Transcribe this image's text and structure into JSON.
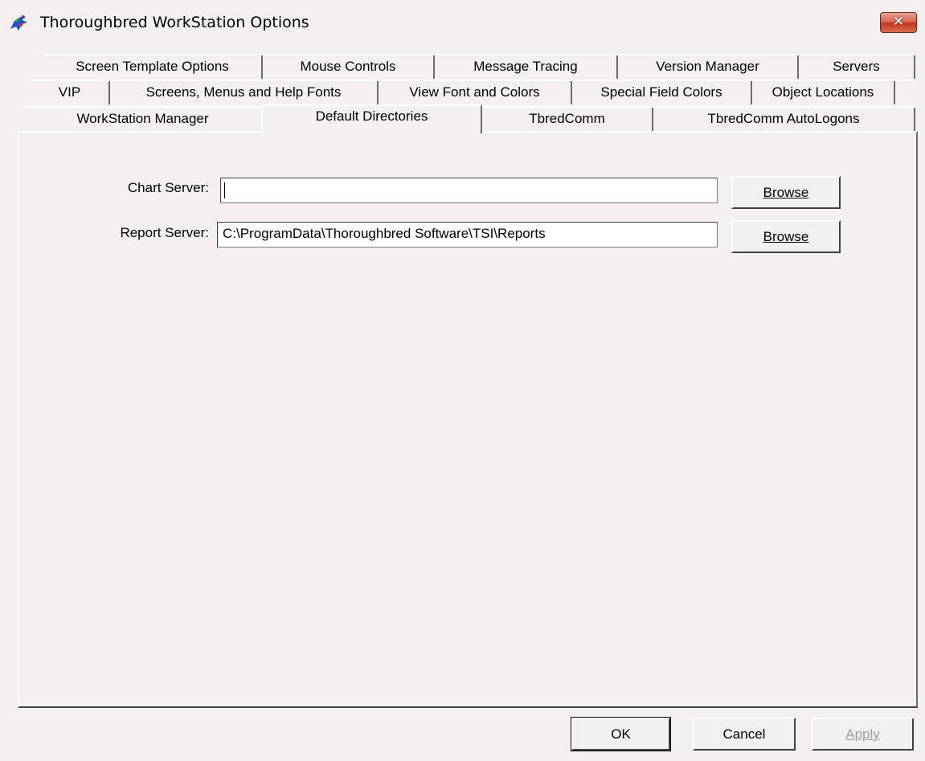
{
  "window": {
    "title": "Thoroughbred WorkStation Options",
    "close_label": "✕"
  },
  "tabs": {
    "row1": [
      "Screen Template Options",
      "Mouse Controls",
      "Message Tracing",
      "Version Manager",
      "Servers"
    ],
    "row2": [
      "VIP",
      "Screens, Menus and Help Fonts",
      "View Font and Colors",
      "Special Field Colors",
      "Object Locations"
    ],
    "row3": [
      "WorkStation Manager",
      "Default Directories",
      "TbredComm",
      "TbredComm AutoLogons"
    ],
    "active": "Default Directories"
  },
  "form": {
    "chart_server": {
      "label": "Chart Server:",
      "value": ""
    },
    "report_server": {
      "label": "Report Server:",
      "value": "C:\\ProgramData\\Thoroughbred Software\\TSI\\Reports"
    },
    "browse_label": "Browse"
  },
  "buttons": {
    "ok": "OK",
    "cancel": "Cancel",
    "apply": "Apply"
  }
}
